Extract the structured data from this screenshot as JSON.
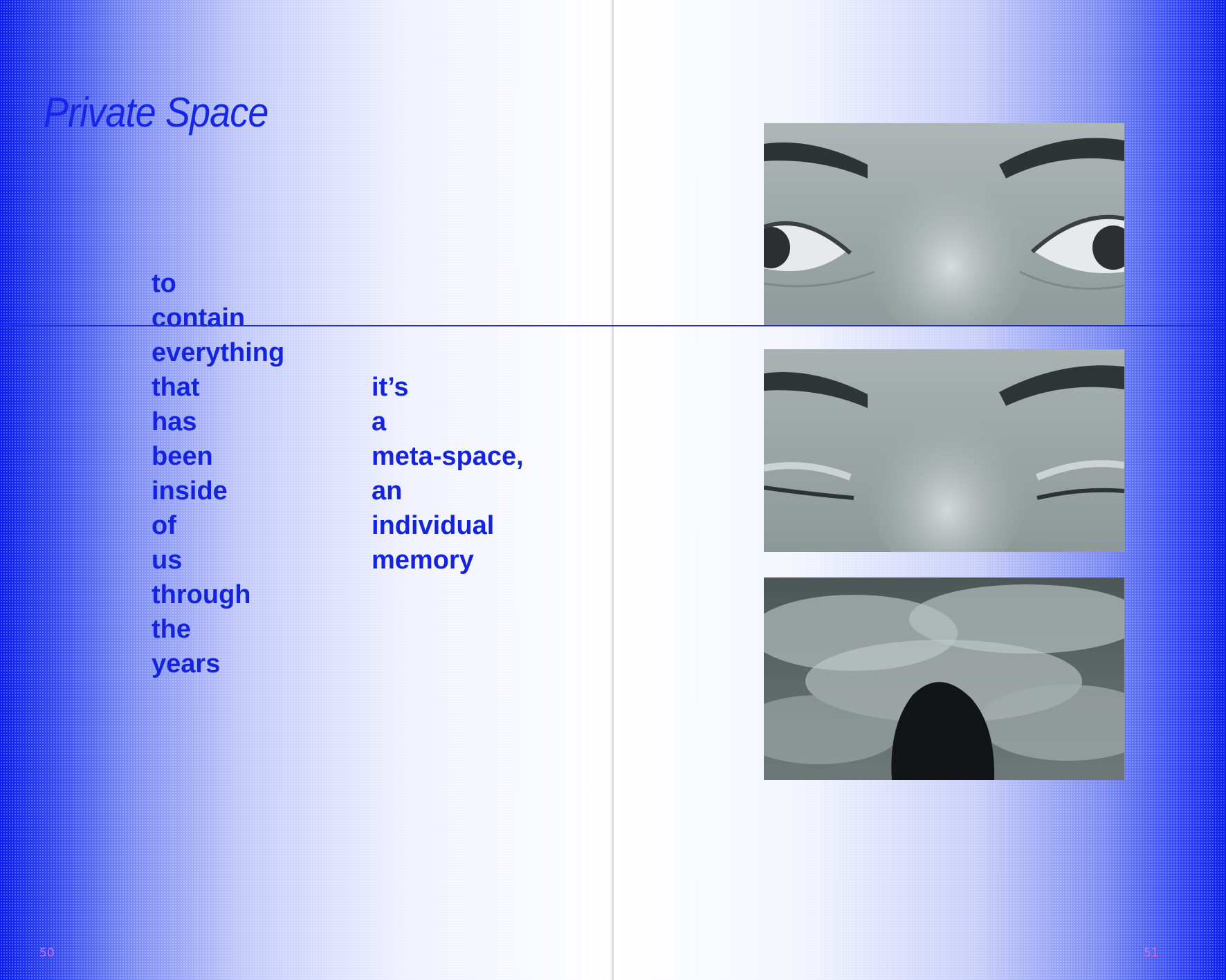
{
  "left_page": {
    "title": "Private Space",
    "column_a": [
      "to",
      "contain",
      "everything",
      "that",
      "has",
      "been",
      "inside",
      "of",
      "us",
      "through",
      "the",
      "years"
    ],
    "column_b": [
      "it’s",
      "a",
      "meta-space,",
      "an",
      "individual",
      "memory"
    ],
    "page_number": "50"
  },
  "right_page": {
    "photos": [
      {
        "subject": "close-up of open eyes"
      },
      {
        "subject": "close-up of closed eyes"
      },
      {
        "subject": "back of a head against a cloudy sky"
      }
    ],
    "page_number": "51"
  },
  "colors": {
    "accent_blue": "#1526e6",
    "page_number_pink": "#d76ad8"
  }
}
